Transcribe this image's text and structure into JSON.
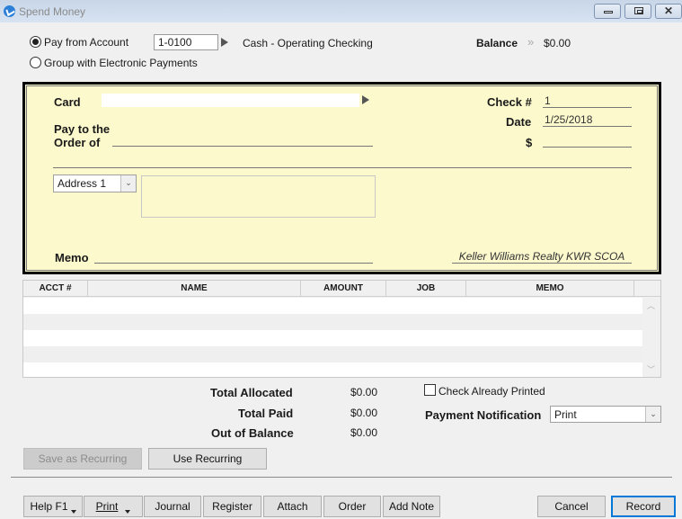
{
  "window": {
    "title": "Spend Money",
    "controls": [
      "minimize",
      "maximize",
      "close"
    ]
  },
  "header": {
    "pay_from_account_label": "Pay from Account",
    "pay_from_account_selected": true,
    "account_number": "1-0100",
    "account_name": "Cash - Operating Checking",
    "group_electronic_label": "Group with Electronic Payments",
    "group_electronic_selected": false,
    "balance_label": "Balance",
    "balance_value": "$0.00"
  },
  "check": {
    "card_label": "Card",
    "card_value": "",
    "pay_to_line1": "Pay to the",
    "pay_to_line2": "Order of",
    "pay_to_value": "",
    "check_no_label": "Check #",
    "check_no_value": "1",
    "date_label": "Date",
    "date_value": "1/25/2018",
    "amount_label": "$",
    "amount_value": "",
    "address_select": "Address 1",
    "address_value": "",
    "memo_label": "Memo",
    "memo_value": "",
    "company_name": "Keller Williams Realty KWR SCOA"
  },
  "grid": {
    "columns": [
      "ACCT #",
      "NAME",
      "AMOUNT",
      "JOB",
      "MEMO"
    ],
    "rows": [
      [],
      [],
      [],
      [],
      []
    ]
  },
  "totals": {
    "total_allocated_label": "Total Allocated",
    "total_allocated_value": "$0.00",
    "total_paid_label": "Total Paid",
    "total_paid_value": "$0.00",
    "out_of_balance_label": "Out of Balance",
    "out_of_balance_value": "$0.00"
  },
  "options": {
    "check_already_printed_label": "Check Already Printed",
    "check_already_printed": false,
    "payment_notification_label": "Payment Notification",
    "payment_notification_value": "Print"
  },
  "buttons": {
    "save_recurring": "Save as Recurring",
    "use_recurring": "Use Recurring",
    "help": "Help F1",
    "print": "Print",
    "journal": "Journal",
    "register": "Register",
    "attach": "Attach",
    "order": "Order",
    "add_note": "Add Note",
    "cancel": "Cancel",
    "record": "Record"
  },
  "colors": {
    "check_background": "#fcf9cd",
    "default_button_border": "#0078d7",
    "app_icon": "#2b7fd6"
  }
}
